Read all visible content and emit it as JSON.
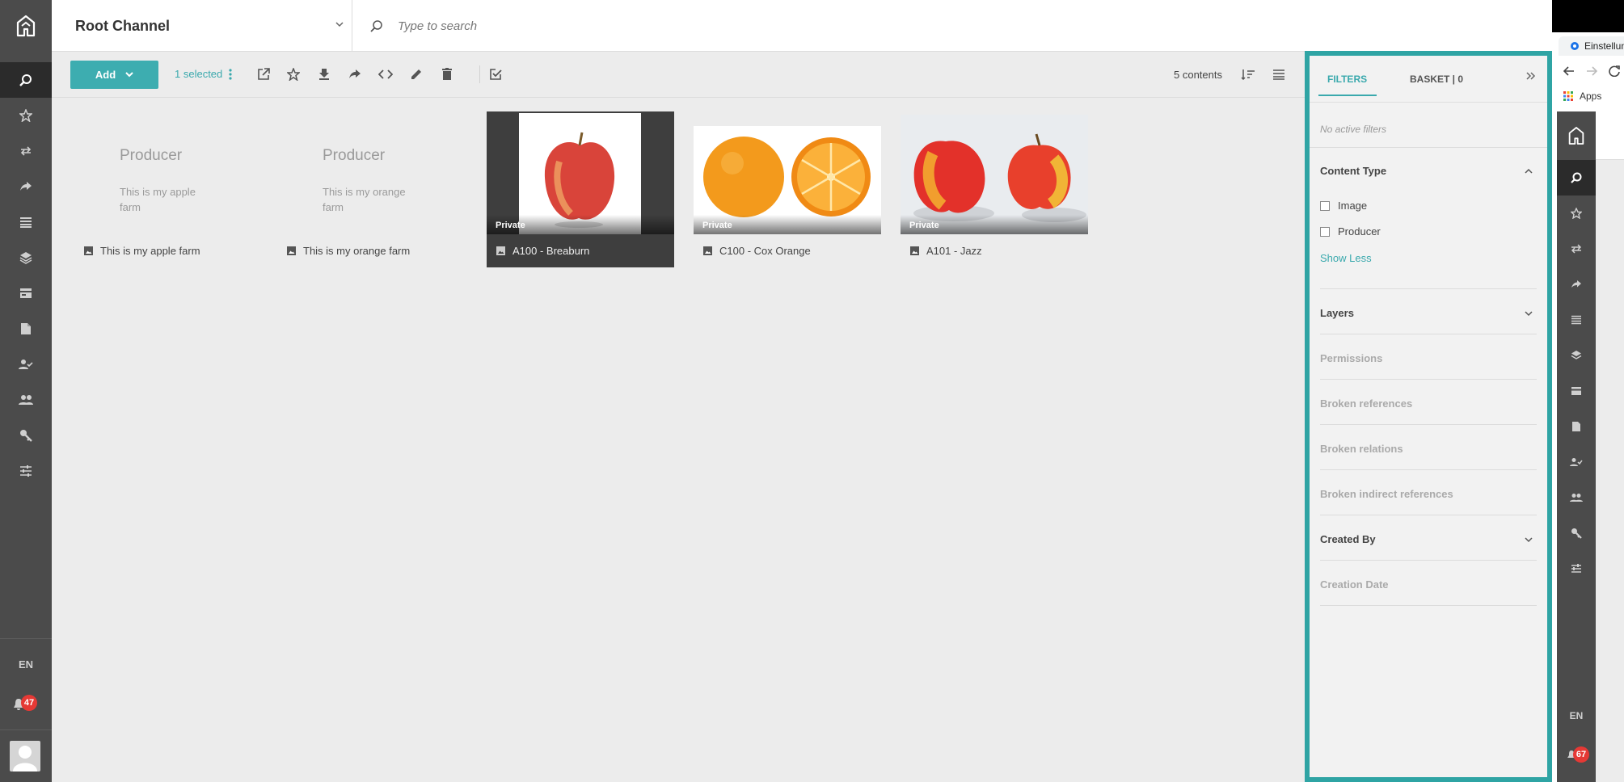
{
  "header": {
    "channel": "Root Channel",
    "search_placeholder": "Type to search"
  },
  "toolbar": {
    "add_label": "Add",
    "selected_label": "1 selected",
    "contents_count": "5 contents"
  },
  "sidebar": {
    "items": [
      "search",
      "favorites",
      "transfer",
      "share",
      "list",
      "layers",
      "card",
      "document",
      "user-check",
      "users",
      "key",
      "sliders"
    ],
    "language": "EN",
    "notifications": "47"
  },
  "cards": [
    {
      "type": "Producer",
      "placeholder_title": "Producer",
      "placeholder_desc": "This is my apple farm",
      "name": "This is my apple farm"
    },
    {
      "type": "Producer",
      "placeholder_title": "Producer",
      "placeholder_desc": "This is my orange farm",
      "name": "This is my orange farm"
    },
    {
      "type": "Image",
      "badge": "Private",
      "name": "A100 - Breaburn",
      "selected": true
    },
    {
      "type": "Image",
      "badge": "Private",
      "name": "C100 - Cox Orange"
    },
    {
      "type": "Image",
      "badge": "Private",
      "name": "A101 - Jazz"
    }
  ],
  "filters": {
    "tab_filters": "FILTERS",
    "tab_basket": "BASKET | 0",
    "no_active": "No active filters",
    "content_type": "Content Type",
    "options": [
      "Image",
      "Producer"
    ],
    "show_less": "Show Less",
    "layers": "Layers",
    "permissions": "Permissions",
    "broken_references": "Broken references",
    "broken_relations": "Broken relations",
    "broken_indirect": "Broken indirect references",
    "created_by": "Created By",
    "creation_date": "Creation Date",
    "accent": "#2fa4a4"
  },
  "second_window": {
    "tab_title": "Einstellun",
    "bookmarks": "Apps",
    "language": "EN",
    "notifications": "67"
  }
}
